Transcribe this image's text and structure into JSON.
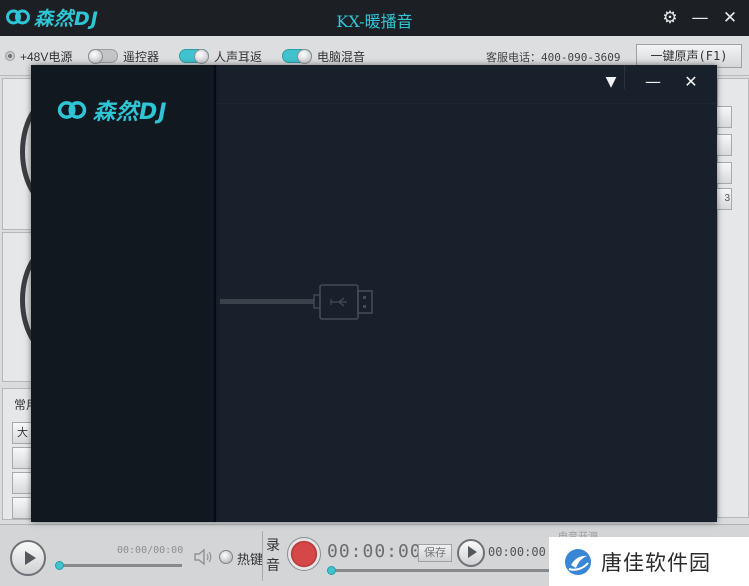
{
  "app": {
    "brand": "森然DJ",
    "title": "KX-暖播音",
    "title_color": "#30c7d6",
    "icons": [
      "settings-icon",
      "minimize-icon",
      "close-icon"
    ]
  },
  "title_buttons": {
    "settings": "⚙",
    "minimize": "—",
    "close": "✕"
  },
  "toolbar": {
    "power_label": "+48V电源",
    "remote_label": "遥控器",
    "monitor_label": "人声耳返",
    "pc_mix_label": "电脑混音",
    "service_phone": "客服电话：400-090-3609",
    "oneclick_label": "一键原声(F1)",
    "toggles": {
      "remote": "off",
      "monitor": "on",
      "pc_mix": "on"
    }
  },
  "background": {
    "changyong_label": "常用",
    "side_button_partial": "3",
    "small_button_partial": "大"
  },
  "bottom": {
    "player_time": "00:00/00:00",
    "hotkey_label": "热键",
    "record_label": "录音",
    "record_time": "00:00:00",
    "save_label": "保存",
    "record_play_time": "00:00:00",
    "partial_label": "电音开源"
  },
  "watermark": {
    "text": "唐佳软件园"
  },
  "overlay": {
    "brand": "森然DJ",
    "menu_icon": "▼",
    "minimize": "—",
    "close": "✕",
    "graphic": "usb-connector-icon"
  },
  "colors": {
    "accent": "#2fc5d4",
    "record": "#d64848",
    "overlay_bg": "#17202b"
  }
}
